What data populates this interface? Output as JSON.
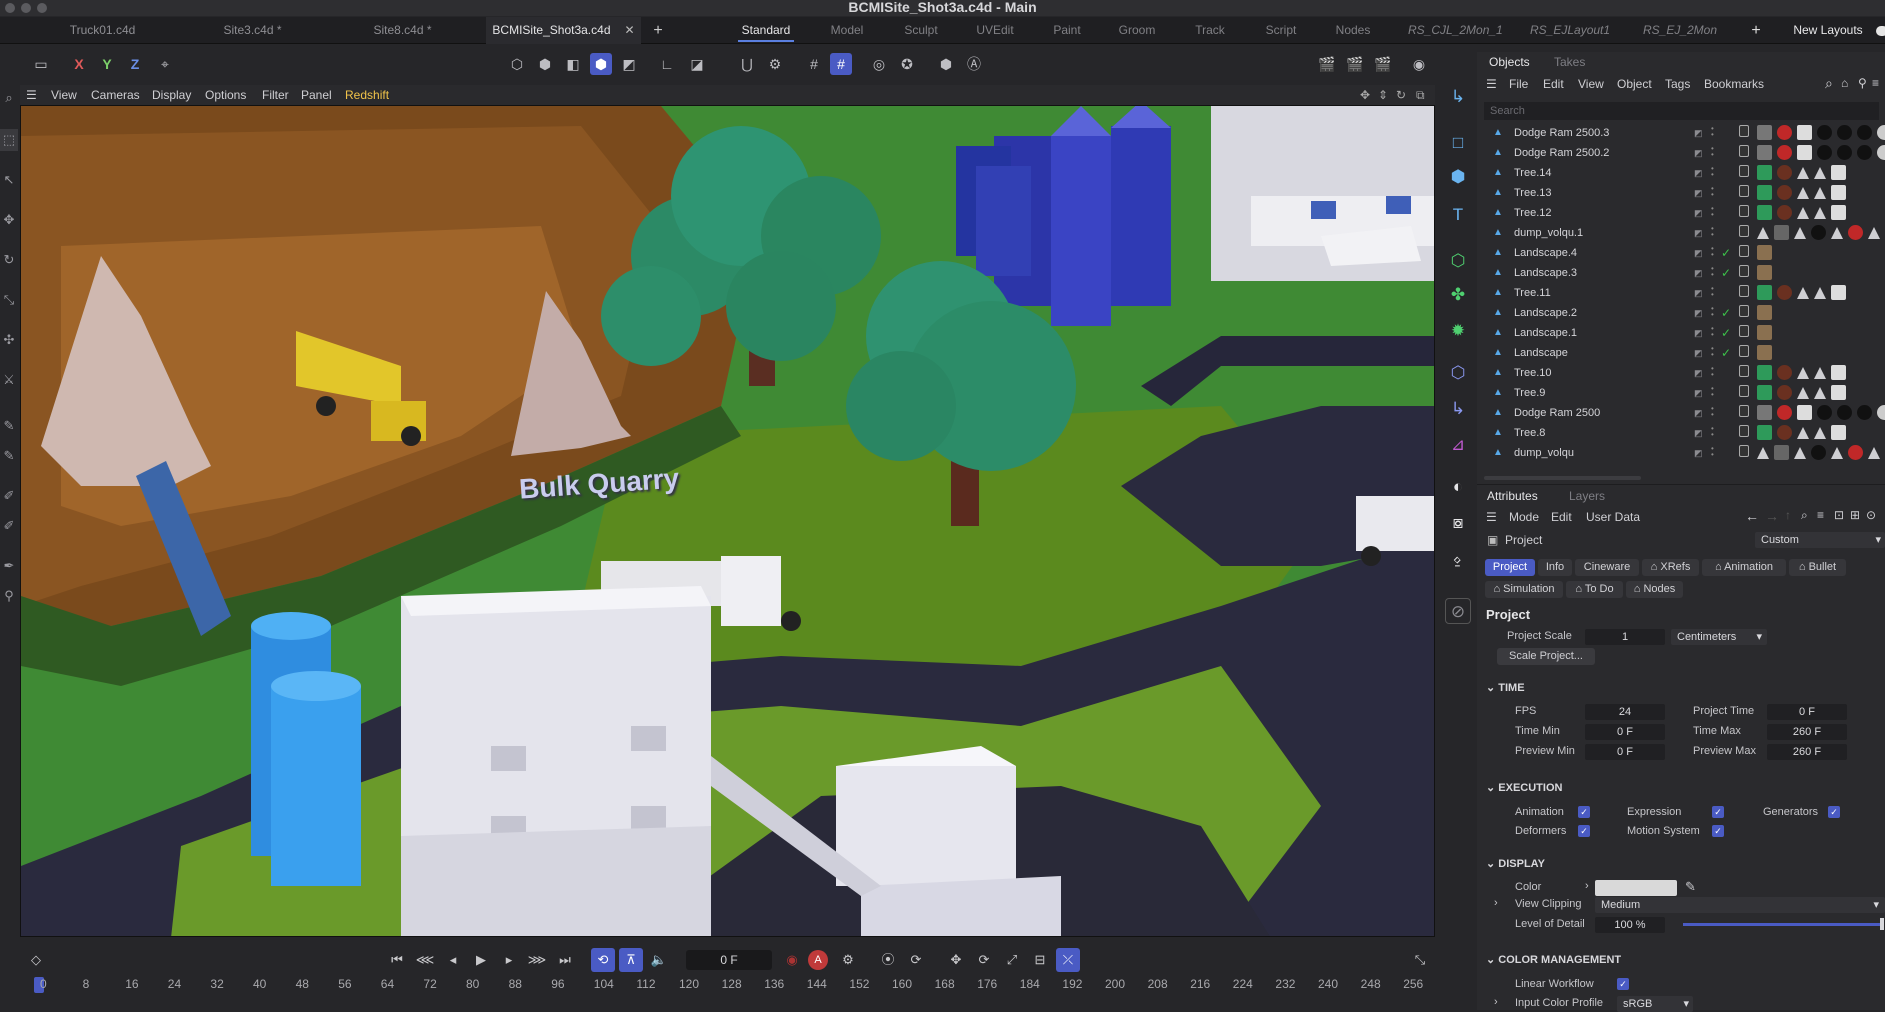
{
  "window": {
    "title": "BCMISite_Shot3a.c4d - Main"
  },
  "doc_tabs": [
    "Truck01.c4d",
    "Site3.c4d *",
    "Site8.c4d *",
    "BCMISite_Shot3a.c4d"
  ],
  "layouts": [
    "Standard",
    "Model",
    "Sculpt",
    "UVEdit",
    "Paint",
    "Groom",
    "Track",
    "Script",
    "Nodes",
    "RS_CJL_2Mon_1",
    "RS_EJLayout1",
    "RS_EJ_2Mon"
  ],
  "new_layouts": "New Layouts",
  "toolbar": {
    "x": "X",
    "y": "Y",
    "z": "Z"
  },
  "viewport_menu": [
    "View",
    "Cameras",
    "Display",
    "Options",
    "Filter",
    "Panel",
    "Redshift"
  ],
  "scene": {
    "sign_text": "Bulk Quarry"
  },
  "transport": {
    "frame": "0 F"
  },
  "timeline": {
    "ticks": [
      "0",
      "8",
      "16",
      "24",
      "32",
      "40",
      "48",
      "56",
      "64",
      "72",
      "80",
      "88",
      "96",
      "104",
      "112",
      "120",
      "128",
      "136",
      "144",
      "152",
      "160",
      "168",
      "176",
      "184",
      "192",
      "200",
      "208",
      "216",
      "224",
      "232",
      "240",
      "248",
      "256"
    ]
  },
  "objects_panel": {
    "tabs": [
      "Objects",
      "Takes"
    ],
    "menu": [
      "File",
      "Edit",
      "View",
      "Object",
      "Tags",
      "Bookmarks"
    ],
    "search_placeholder": "Search",
    "rows": [
      {
        "name": "Dodge Ram 2500.3",
        "check": ""
      },
      {
        "name": "Dodge Ram 2500.2",
        "check": ""
      },
      {
        "name": "Tree.14",
        "check": ""
      },
      {
        "name": "Tree.13",
        "check": ""
      },
      {
        "name": "Tree.12",
        "check": ""
      },
      {
        "name": "dump_volqu.1",
        "check": ""
      },
      {
        "name": "Landscape.4",
        "check": "✓"
      },
      {
        "name": "Landscape.3",
        "check": "✓"
      },
      {
        "name": "Tree.11",
        "check": ""
      },
      {
        "name": "Landscape.2",
        "check": "✓"
      },
      {
        "name": "Landscape.1",
        "check": "✓"
      },
      {
        "name": "Landscape",
        "check": "✓"
      },
      {
        "name": "Tree.10",
        "check": ""
      },
      {
        "name": "Tree.9",
        "check": ""
      },
      {
        "name": "Dodge Ram 2500",
        "check": ""
      },
      {
        "name": "Tree.8",
        "check": ""
      },
      {
        "name": "dump_volqu",
        "check": ""
      }
    ]
  },
  "attributes": {
    "tabs": [
      "Attributes",
      "Layers"
    ],
    "menu": [
      "Mode",
      "Edit",
      "User Data"
    ],
    "object_label": "Project",
    "preset": "Custom",
    "subtabs": [
      "Project",
      "Info",
      "Cineware",
      "XRefs",
      "Animation",
      "Bullet",
      "Simulation",
      "To Do",
      "Nodes"
    ],
    "heading": "Project",
    "project_scale_label": "Project Scale",
    "project_scale": "1",
    "unit": "Centimeters",
    "scale_button": "Scale Project...",
    "time": {
      "title": "TIME",
      "fps_label": "FPS",
      "fps": "24",
      "project_time_label": "Project Time",
      "project_time": "0 F",
      "time_min_label": "Time Min",
      "time_min": "0 F",
      "time_max_label": "Time Max",
      "time_max": "260 F",
      "preview_min_label": "Preview Min",
      "preview_min": "0 F",
      "preview_max_label": "Preview Max",
      "preview_max": "260 F"
    },
    "execution": {
      "title": "EXECUTION",
      "animation": "Animation",
      "expression": "Expression",
      "generators": "Generators",
      "deformers": "Deformers",
      "motion_system": "Motion System"
    },
    "display": {
      "title": "DISPLAY",
      "color_label": "Color",
      "color_value": "#d9d9d9",
      "view_clipping_label": "View Clipping",
      "view_clipping": "Medium",
      "lod_label": "Level of Detail",
      "lod": "100 %"
    },
    "color_management": {
      "title": "COLOR MANAGEMENT",
      "linear_workflow": "Linear Workflow",
      "input_profile_label": "Input Color Profile",
      "input_profile": "sRGB"
    }
  },
  "colors": {
    "accent": "#4a5bc4",
    "check_green": "#3cc24a",
    "object_icon": "#58a9e8"
  }
}
